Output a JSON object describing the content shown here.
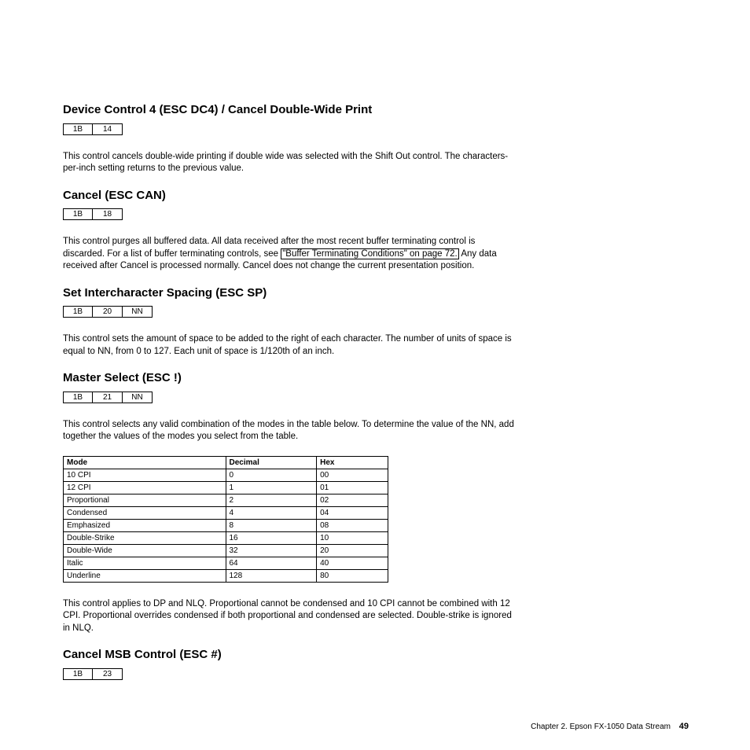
{
  "sections": {
    "dc4": {
      "title": "Device Control 4 (ESC DC4) / Cancel Double-Wide Print",
      "codes": [
        "1B",
        "14"
      ],
      "para1": "This control cancels double-wide printing if double wide was selected with the Shift Out control. The characters-per-inch setting returns to the previous value."
    },
    "can": {
      "title": "Cancel (ESC CAN)",
      "codes": [
        "1B",
        "18"
      ],
      "para1_a": "This control purges all buffered data. All data received after the most recent buffer terminating control is discarded. For a list of buffer terminating controls, see ",
      "link": "\"Buffer Terminating Conditions\" on page 72.",
      "para1_b": " Any data received after Cancel is processed normally. Cancel does not change the current presentation position."
    },
    "sp": {
      "title": "Set Intercharacter Spacing (ESC SP)",
      "codes": [
        "1B",
        "20",
        "NN"
      ],
      "para1": "This control sets the amount of space to be added to the right of each character. The number of units of space is equal to NN, from 0 to 127. Each unit of space is 1/120th of an inch."
    },
    "ms": {
      "title": "Master Select (ESC !)",
      "codes": [
        "1B",
        "21",
        "NN"
      ],
      "para1": "This control selects any valid combination of the modes in the table below. To determine the value of the NN, add together the values of the modes you select from the table.",
      "table": {
        "headers": [
          "Mode",
          "Decimal",
          "Hex"
        ],
        "rows": [
          [
            "10 CPI",
            "0",
            "00"
          ],
          [
            "12 CPI",
            "1",
            "01"
          ],
          [
            "Proportional",
            "2",
            "02"
          ],
          [
            "Condensed",
            "4",
            "04"
          ],
          [
            "Emphasized",
            "8",
            "08"
          ],
          [
            "Double-Strike",
            "16",
            "10"
          ],
          [
            "Double-Wide",
            "32",
            "20"
          ],
          [
            "Italic",
            "64",
            "40"
          ],
          [
            "Underline",
            "128",
            "80"
          ]
        ]
      },
      "para2": "This control applies to DP and NLQ. Proportional cannot be condensed and 10 CPI cannot be combined with 12 CPI. Proportional overrides condensed if both proportional and condensed are selected. Double-strike is ignored in NLQ."
    },
    "msb": {
      "title": "Cancel MSB Control (ESC #)",
      "codes": [
        "1B",
        "23"
      ]
    }
  },
  "footer": {
    "chapter": "Chapter 2. Epson FX-1050 Data Stream",
    "page": "49"
  }
}
